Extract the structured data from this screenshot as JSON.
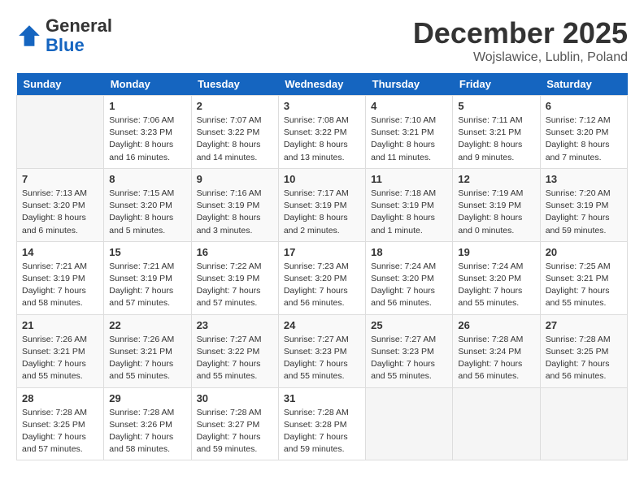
{
  "logo": {
    "line1": "General",
    "line2": "Blue"
  },
  "title": "December 2025",
  "subtitle": "Wojslawice, Lublin, Poland",
  "days_of_week": [
    "Sunday",
    "Monday",
    "Tuesday",
    "Wednesday",
    "Thursday",
    "Friday",
    "Saturday"
  ],
  "weeks": [
    [
      {
        "day": "",
        "info": ""
      },
      {
        "day": "1",
        "info": "Sunrise: 7:06 AM\nSunset: 3:23 PM\nDaylight: 8 hours\nand 16 minutes."
      },
      {
        "day": "2",
        "info": "Sunrise: 7:07 AM\nSunset: 3:22 PM\nDaylight: 8 hours\nand 14 minutes."
      },
      {
        "day": "3",
        "info": "Sunrise: 7:08 AM\nSunset: 3:22 PM\nDaylight: 8 hours\nand 13 minutes."
      },
      {
        "day": "4",
        "info": "Sunrise: 7:10 AM\nSunset: 3:21 PM\nDaylight: 8 hours\nand 11 minutes."
      },
      {
        "day": "5",
        "info": "Sunrise: 7:11 AM\nSunset: 3:21 PM\nDaylight: 8 hours\nand 9 minutes."
      },
      {
        "day": "6",
        "info": "Sunrise: 7:12 AM\nSunset: 3:20 PM\nDaylight: 8 hours\nand 7 minutes."
      }
    ],
    [
      {
        "day": "7",
        "info": "Sunrise: 7:13 AM\nSunset: 3:20 PM\nDaylight: 8 hours\nand 6 minutes."
      },
      {
        "day": "8",
        "info": "Sunrise: 7:15 AM\nSunset: 3:20 PM\nDaylight: 8 hours\nand 5 minutes."
      },
      {
        "day": "9",
        "info": "Sunrise: 7:16 AM\nSunset: 3:19 PM\nDaylight: 8 hours\nand 3 minutes."
      },
      {
        "day": "10",
        "info": "Sunrise: 7:17 AM\nSunset: 3:19 PM\nDaylight: 8 hours\nand 2 minutes."
      },
      {
        "day": "11",
        "info": "Sunrise: 7:18 AM\nSunset: 3:19 PM\nDaylight: 8 hours\nand 1 minute."
      },
      {
        "day": "12",
        "info": "Sunrise: 7:19 AM\nSunset: 3:19 PM\nDaylight: 8 hours\nand 0 minutes."
      },
      {
        "day": "13",
        "info": "Sunrise: 7:20 AM\nSunset: 3:19 PM\nDaylight: 7 hours\nand 59 minutes."
      }
    ],
    [
      {
        "day": "14",
        "info": "Sunrise: 7:21 AM\nSunset: 3:19 PM\nDaylight: 7 hours\nand 58 minutes."
      },
      {
        "day": "15",
        "info": "Sunrise: 7:21 AM\nSunset: 3:19 PM\nDaylight: 7 hours\nand 57 minutes."
      },
      {
        "day": "16",
        "info": "Sunrise: 7:22 AM\nSunset: 3:19 PM\nDaylight: 7 hours\nand 57 minutes."
      },
      {
        "day": "17",
        "info": "Sunrise: 7:23 AM\nSunset: 3:20 PM\nDaylight: 7 hours\nand 56 minutes."
      },
      {
        "day": "18",
        "info": "Sunrise: 7:24 AM\nSunset: 3:20 PM\nDaylight: 7 hours\nand 56 minutes."
      },
      {
        "day": "19",
        "info": "Sunrise: 7:24 AM\nSunset: 3:20 PM\nDaylight: 7 hours\nand 55 minutes."
      },
      {
        "day": "20",
        "info": "Sunrise: 7:25 AM\nSunset: 3:21 PM\nDaylight: 7 hours\nand 55 minutes."
      }
    ],
    [
      {
        "day": "21",
        "info": "Sunrise: 7:26 AM\nSunset: 3:21 PM\nDaylight: 7 hours\nand 55 minutes."
      },
      {
        "day": "22",
        "info": "Sunrise: 7:26 AM\nSunset: 3:21 PM\nDaylight: 7 hours\nand 55 minutes."
      },
      {
        "day": "23",
        "info": "Sunrise: 7:27 AM\nSunset: 3:22 PM\nDaylight: 7 hours\nand 55 minutes."
      },
      {
        "day": "24",
        "info": "Sunrise: 7:27 AM\nSunset: 3:23 PM\nDaylight: 7 hours\nand 55 minutes."
      },
      {
        "day": "25",
        "info": "Sunrise: 7:27 AM\nSunset: 3:23 PM\nDaylight: 7 hours\nand 55 minutes."
      },
      {
        "day": "26",
        "info": "Sunrise: 7:28 AM\nSunset: 3:24 PM\nDaylight: 7 hours\nand 56 minutes."
      },
      {
        "day": "27",
        "info": "Sunrise: 7:28 AM\nSunset: 3:25 PM\nDaylight: 7 hours\nand 56 minutes."
      }
    ],
    [
      {
        "day": "28",
        "info": "Sunrise: 7:28 AM\nSunset: 3:25 PM\nDaylight: 7 hours\nand 57 minutes."
      },
      {
        "day": "29",
        "info": "Sunrise: 7:28 AM\nSunset: 3:26 PM\nDaylight: 7 hours\nand 58 minutes."
      },
      {
        "day": "30",
        "info": "Sunrise: 7:28 AM\nSunset: 3:27 PM\nDaylight: 7 hours\nand 59 minutes."
      },
      {
        "day": "31",
        "info": "Sunrise: 7:28 AM\nSunset: 3:28 PM\nDaylight: 7 hours\nand 59 minutes."
      },
      {
        "day": "",
        "info": ""
      },
      {
        "day": "",
        "info": ""
      },
      {
        "day": "",
        "info": ""
      }
    ]
  ]
}
